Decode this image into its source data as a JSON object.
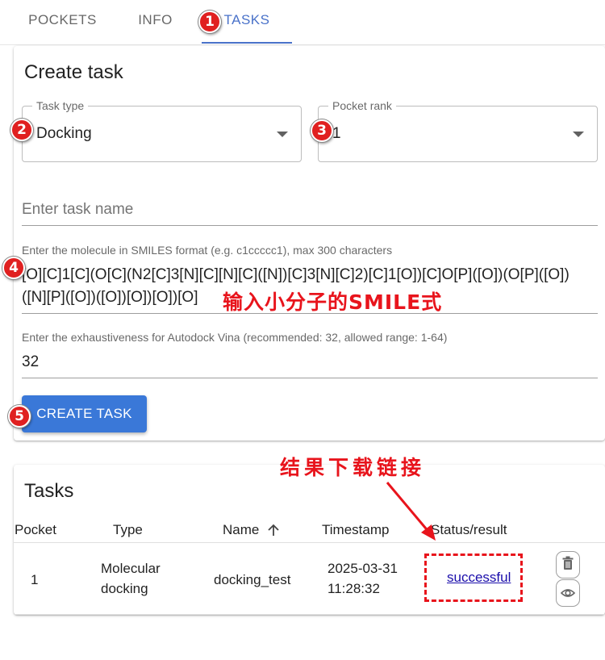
{
  "tabs": [
    {
      "label": "POCKETS",
      "active": false
    },
    {
      "label": "INFO",
      "active": false
    },
    {
      "label": "TASKS",
      "active": true
    }
  ],
  "create_task": {
    "title": "Create task",
    "task_type": {
      "label": "Task type",
      "value": "Docking"
    },
    "pocket_rank": {
      "label": "Pocket rank",
      "value": "1"
    },
    "task_name": {
      "placeholder": "Enter task name",
      "value": ""
    },
    "smiles": {
      "label": "Enter the molecule in SMILES format (e.g. c1ccccc1), max 300 characters",
      "line1": "[O][C]1[C](O[C](N2[C]3[N][C][N][C]([N])[C]3[N][C]2)[C]1[O])[C]O[P]([O])(O[P]([O])",
      "line2": "([N][P]([O])([O])[O])[O])[O]"
    },
    "exhaustiveness": {
      "label": "Enter the exhaustiveness for Autodock Vina (recommended: 32, allowed range: 1-64)",
      "value": "32"
    },
    "create_button": "CREATE TASK"
  },
  "tasks": {
    "title": "Tasks",
    "columns": [
      "Pocket",
      "Type",
      "Name",
      "Timestamp",
      "Status/result"
    ],
    "sort_column": "Name",
    "sort_direction": "ascending",
    "rows": [
      {
        "pocket": "1",
        "type_line1": "Molecular",
        "type_line2": "docking",
        "name": "docking_test",
        "timestamp_date": "2025-03-31",
        "timestamp_time": "11:28:32",
        "status": "successful"
      }
    ]
  },
  "annotations": {
    "badges": [
      "1",
      "2",
      "3",
      "4",
      "5"
    ],
    "smiles_note": "输入小分子的SMILE式",
    "result_note": "结果下载链接",
    "color": "#e8141c"
  },
  "icons": {
    "delete": "trash-icon",
    "view": "eye-icon",
    "sort": "arrow-up-icon",
    "dropdown": "caret-down-icon"
  },
  "colors": {
    "accent": "#4a72c9",
    "button": "#3a78d8",
    "link": "#1a0dab"
  }
}
